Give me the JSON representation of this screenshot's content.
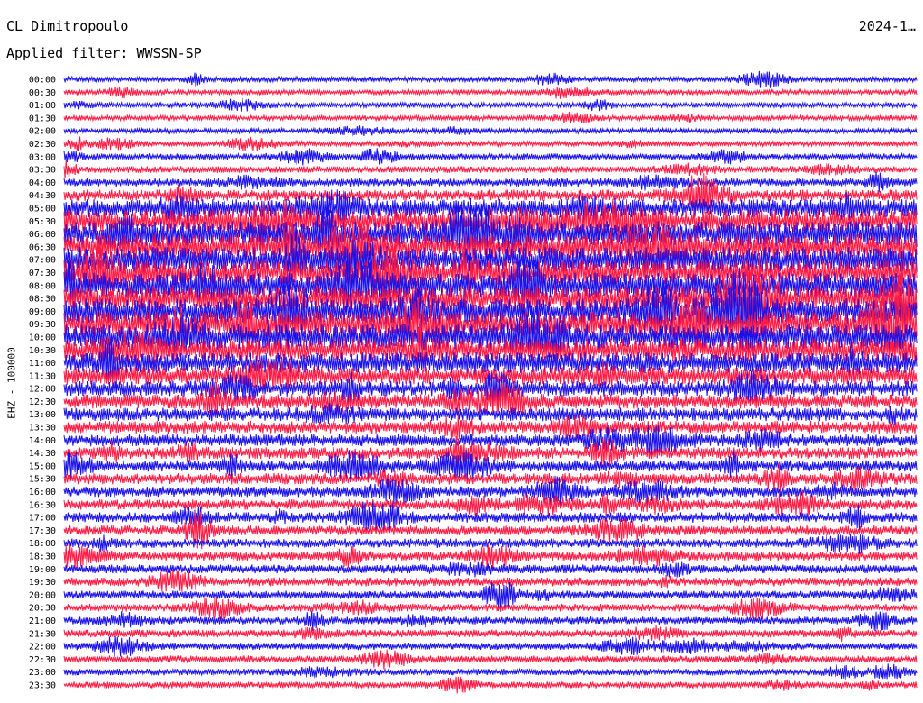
{
  "header": {
    "station": "CL Dimitropoulo",
    "date": "2024-1…",
    "filter_label": "Applied filter: WWSSN-SP",
    "channel_label": "EHZ - 100000"
  },
  "chart_data": {
    "type": "line",
    "title": "",
    "xlabel": "",
    "ylabel": "EHZ - 100000",
    "row_labels": [
      "00:00",
      "00:30",
      "01:00",
      "01:30",
      "02:00",
      "02:30",
      "03:00",
      "03:30",
      "04:00",
      "04:30",
      "05:00",
      "05:30",
      "06:00",
      "06:30",
      "07:00",
      "07:30",
      "08:00",
      "08:30",
      "09:00",
      "09:30",
      "10:00",
      "10:30",
      "11:00",
      "11:30",
      "12:00",
      "12:30",
      "13:00",
      "13:30",
      "14:00",
      "14:30",
      "15:00",
      "15:30",
      "16:00",
      "16:30",
      "17:00",
      "17:30",
      "18:00",
      "18:30",
      "19:00",
      "19:30",
      "20:00",
      "20:30",
      "21:00",
      "21:30",
      "22:00",
      "22:30",
      "23:00",
      "23:30"
    ],
    "trace_colors": [
      "#1a10e8",
      "#ff1a44"
    ],
    "relative_noise_level": [
      1,
      1,
      1,
      1,
      1,
      1,
      1.2,
      1.3,
      1.6,
      2.2,
      3.5,
      4.5,
      5,
      5,
      5,
      5,
      5,
      5,
      5,
      5,
      5,
      4.5,
      4,
      3.5,
      3,
      2.8,
      2.6,
      2.5,
      2.4,
      2.3,
      2.2,
      2.2,
      2.1,
      2,
      2,
      1.9,
      1.8,
      1.8,
      1.7,
      1.7,
      1.6,
      1.5,
      1.5,
      1.5,
      1.4,
      1.4,
      1.3,
      1.3
    ],
    "grid": false,
    "legend": "none"
  }
}
